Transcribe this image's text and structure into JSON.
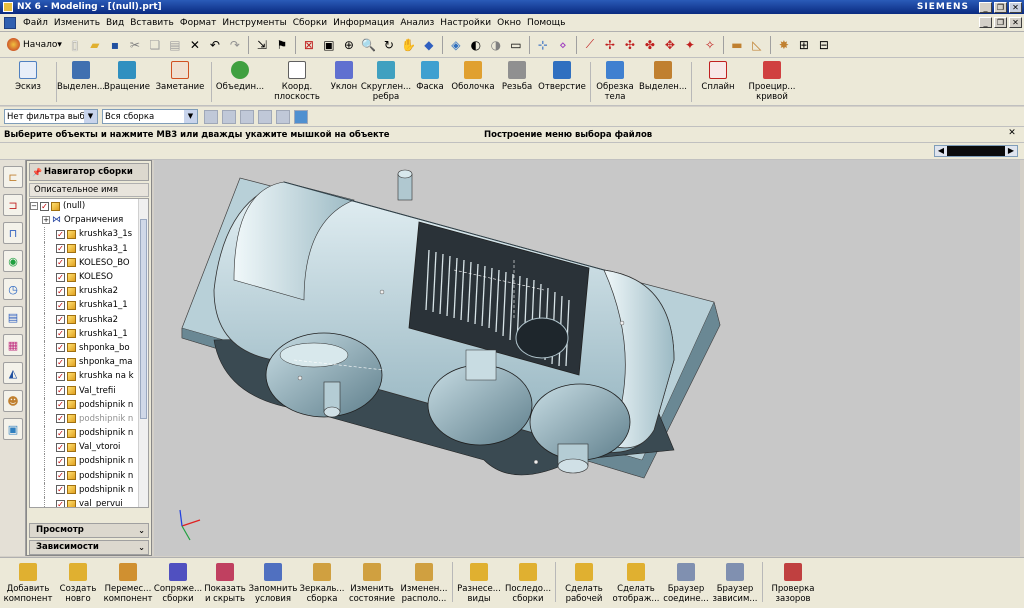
{
  "window": {
    "title": "NX 6 - Modeling - [(null).prt]",
    "brand": "SIEMENS"
  },
  "menu": [
    "Файл",
    "Изменить",
    "Вид",
    "Вставить",
    "Формат",
    "Инструменты",
    "Сборки",
    "Информация",
    "Анализ",
    "Настройки",
    "Окно",
    "Помощь"
  ],
  "toolbar1": {
    "start_label": "Начало"
  },
  "features": [
    {
      "label": "Эскиз",
      "icon": "sketch-icon",
      "color": "#5080c0"
    },
    {
      "label": "Выделен...",
      "icon": "extrude-icon",
      "color": "#4070b0"
    },
    {
      "label": "Вращение",
      "icon": "revolve-icon",
      "color": "#3090c0"
    },
    {
      "label": "Заметание",
      "icon": "sweep-icon",
      "color": "#d05020"
    },
    {
      "label": "Объедин...",
      "icon": "unite-icon",
      "color": "#40a040"
    },
    {
      "label": "Коорд. плоскость",
      "icon": "datum-plane-icon",
      "color": "#ffffff"
    },
    {
      "label": "Уклон",
      "icon": "draft-icon",
      "color": "#6070d0"
    },
    {
      "label": "Скруглен... ребра",
      "icon": "edge-blend-icon",
      "color": "#40a0c0"
    },
    {
      "label": "Фаска",
      "icon": "chamfer-icon",
      "color": "#40a0d0"
    },
    {
      "label": "Оболочка",
      "icon": "shell-icon",
      "color": "#e0a030"
    },
    {
      "label": "Резьба",
      "icon": "thread-icon",
      "color": "#909090"
    },
    {
      "label": "Отверстие",
      "icon": "hole-icon",
      "color": "#3070c0"
    },
    {
      "label": "Обрезка тела",
      "icon": "trim-body-icon",
      "color": "#4080d0"
    },
    {
      "label": "Выделен...",
      "icon": "extract-icon",
      "color": "#c08030"
    },
    {
      "label": "Сплайн",
      "icon": "spline-icon",
      "color": "#c02020"
    },
    {
      "label": "Проецир... кривой",
      "icon": "project-curve-icon",
      "color": "#d04040"
    }
  ],
  "filter": {
    "type_filter": "Нет фильтра выбо",
    "scope": "Вся сборка"
  },
  "status": {
    "prompt": "Выберите объекты и нажмите МВ3 или дважды укажите мышкой на объекте",
    "message": "Построение меню выбора файлов"
  },
  "navigator": {
    "title": "Навигатор сборки",
    "column": "Описательное имя детали",
    "root": "(null)",
    "constraints": "Ограничения",
    "parts": [
      {
        "name": "krushka3_1s",
        "dim": false
      },
      {
        "name": "krushka3_1",
        "dim": false
      },
      {
        "name": "KOLESO_BO",
        "dim": false
      },
      {
        "name": "KOLESO",
        "dim": false
      },
      {
        "name": "krushka2",
        "dim": false
      },
      {
        "name": "krushka1_1",
        "dim": false
      },
      {
        "name": "krushka2",
        "dim": false
      },
      {
        "name": "krushka1_1",
        "dim": false
      },
      {
        "name": "shponka_bo",
        "dim": false
      },
      {
        "name": "shponka_ma",
        "dim": false
      },
      {
        "name": "krushka na k",
        "dim": false
      },
      {
        "name": "Val_trefii",
        "dim": false
      },
      {
        "name": "podshipnik n",
        "dim": false
      },
      {
        "name": "podshipnik n",
        "dim": true
      },
      {
        "name": "podshipnik n",
        "dim": false
      },
      {
        "name": "Val_vtoroi",
        "dim": false
      },
      {
        "name": "podshipnik n",
        "dim": false
      },
      {
        "name": "podshipnik n",
        "dim": false
      },
      {
        "name": "podshipnik n",
        "dim": false
      },
      {
        "name": "val_pervui",
        "dim": false
      }
    ],
    "preview": "Просмотр",
    "dependencies": "Зависимости"
  },
  "assembly": [
    {
      "label": "Добавить компонент",
      "icon": "add-component-icon"
    },
    {
      "label": "Создать новго",
      "icon": "create-new-icon"
    },
    {
      "label": "Перемес... компонент",
      "icon": "move-component-icon"
    },
    {
      "label": "Сопряже... сборки",
      "icon": "mate-icon"
    },
    {
      "label": "Показать и скрыть",
      "icon": "show-hide-icon"
    },
    {
      "label": "Запомнить условия",
      "icon": "remember-icon"
    },
    {
      "label": "Зеркаль... сборка",
      "icon": "mirror-icon"
    },
    {
      "label": "Изменить состояние",
      "icon": "change-state-icon"
    },
    {
      "label": "Изменен... располо...",
      "icon": "arrangement-icon"
    },
    {
      "label": "Разнесе... виды",
      "icon": "exploded-views-icon"
    },
    {
      "label": "Последо... сборки",
      "icon": "sequence-icon"
    },
    {
      "label": "Сделать рабочей",
      "icon": "make-work-icon"
    },
    {
      "label": "Сделать отображ...",
      "icon": "make-displayed-icon"
    },
    {
      "label": "Браузер соедине...",
      "icon": "wave-browser-icon"
    },
    {
      "label": "Браузер зависим...",
      "icon": "dependency-browser-icon"
    },
    {
      "label": "Проверка зазоров",
      "icon": "clearance-icon"
    }
  ],
  "colors": {
    "accent": "#0a2a80",
    "viewport": "#c8c8c8",
    "model": "#a8c8d0"
  }
}
